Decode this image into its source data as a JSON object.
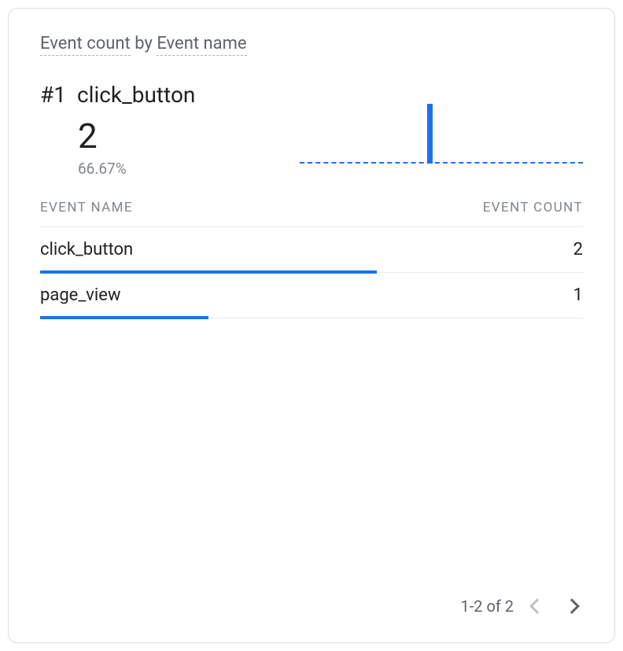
{
  "card": {
    "title_metric": "Event count",
    "title_by": " by ",
    "title_dimension": "Event name",
    "top": {
      "rank": "#1",
      "name": "click_button",
      "value": "2",
      "pct": "66.67%"
    },
    "table": {
      "header_name": "EVENT NAME",
      "header_count": "EVENT COUNT",
      "rows": [
        {
          "name": "click_button",
          "count": "2",
          "bar_pct": 66.67
        },
        {
          "name": "page_view",
          "count": "1",
          "bar_pct": 33.33
        }
      ]
    },
    "pager": {
      "label": "1-2 of 2",
      "prev_disabled": true,
      "next_disabled": false
    }
  },
  "chart_data": {
    "type": "bar",
    "title": "Event count by Event name",
    "xlabel": "Event name",
    "ylabel": "Event count",
    "categories": [
      "click_button",
      "page_view"
    ],
    "values": [
      2,
      1
    ],
    "ylim": [
      0,
      3
    ]
  }
}
